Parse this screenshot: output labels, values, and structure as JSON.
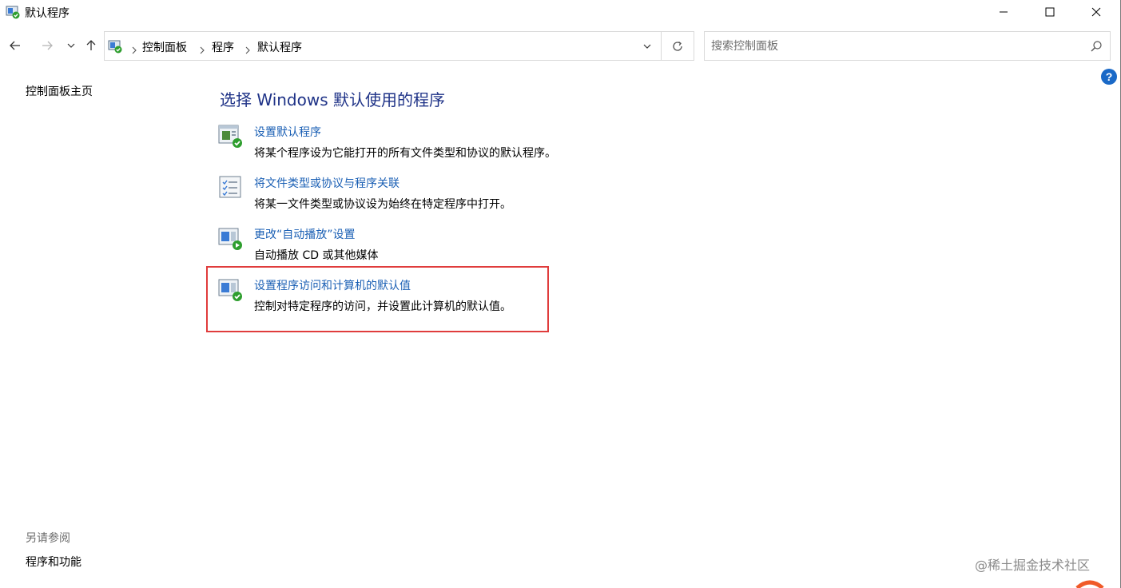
{
  "window": {
    "title": "默认程序"
  },
  "nav": {
    "back_icon": "arrow-left-icon",
    "forward_icon": "arrow-right-icon",
    "recent_icon": "chevron-down-icon",
    "up_icon": "arrow-up-icon"
  },
  "breadcrumb": {
    "items": [
      "控制面板",
      "程序",
      "默认程序"
    ]
  },
  "search": {
    "placeholder": "搜索控制面板",
    "value": ""
  },
  "sidebar": {
    "home_link": "控制面板主页",
    "see_also_header": "另请参阅",
    "see_also_links": [
      "程序和功能"
    ]
  },
  "main": {
    "heading": "选择 Windows 默认使用的程序",
    "tasks": [
      {
        "icon": "default-programs-check-icon",
        "title": "设置默认程序",
        "description": "将某个程序设为它能打开的所有文件类型和协议的默认程序。"
      },
      {
        "icon": "file-association-list-icon",
        "title": "将文件类型或协议与程序关联",
        "description": "将某一文件类型或协议设为始终在特定程序中打开。"
      },
      {
        "icon": "autoplay-icon",
        "title": "更改“自动播放”设置",
        "description": "自动播放 CD 或其他媒体"
      },
      {
        "icon": "program-access-defaults-icon",
        "title": "设置程序访问和计算机的默认值",
        "description": "控制对特定程序的访问，并设置此计算机的默认值。"
      }
    ]
  },
  "watermark": {
    "text": "@稀土掘金技术社区"
  },
  "colors": {
    "link": "#1a5fb4",
    "heading": "#1e3287",
    "highlight": "#e03c3c",
    "help": "#1a69c7"
  }
}
